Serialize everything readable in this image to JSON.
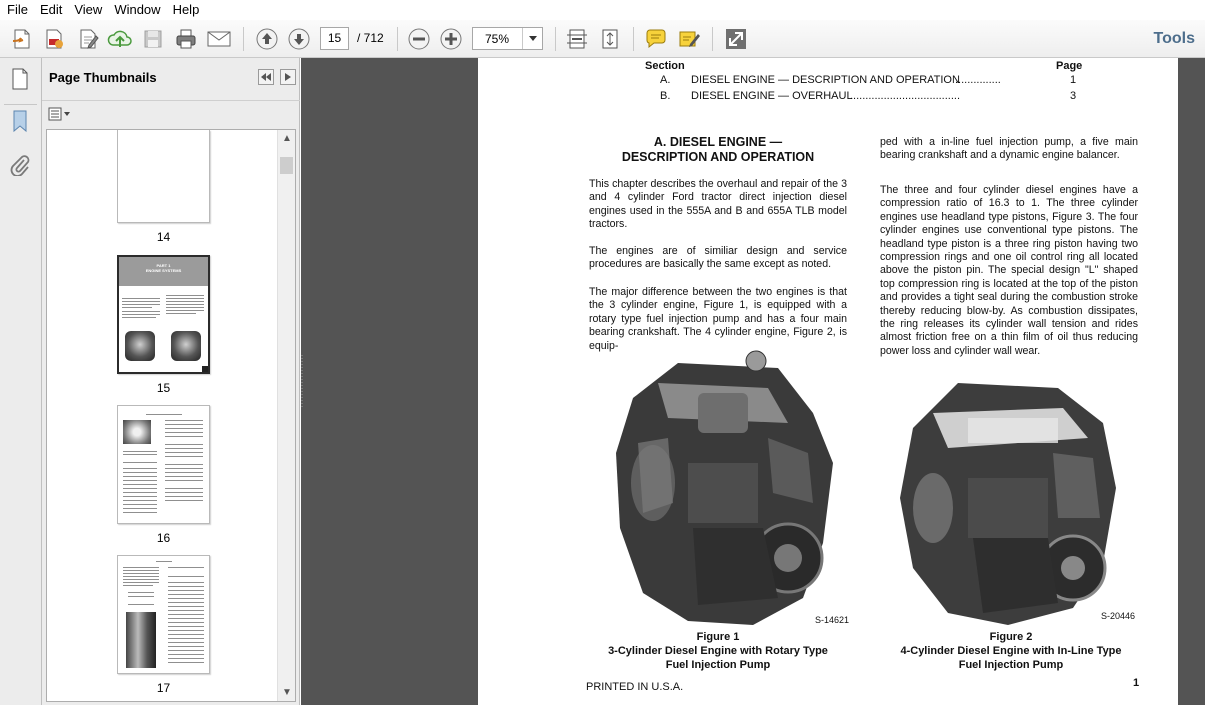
{
  "menu": [
    "File",
    "Edit",
    "View",
    "Window",
    "Help"
  ],
  "toolbar": {
    "page_current": "15",
    "page_total": "/ 712",
    "zoom": "75%",
    "tools_label": "Tools"
  },
  "sidebar": {
    "title": "Page Thumbnails",
    "thumbnails": [
      {
        "label": "14"
      },
      {
        "label": "15",
        "header_line1": "PART 1",
        "header_line2": "ENGINE SYSTEMS"
      },
      {
        "label": "16"
      },
      {
        "label": "17"
      }
    ]
  },
  "document": {
    "toc": {
      "section_header": "Section",
      "page_header": "Page",
      "rows": [
        {
          "letter": "A.",
          "title": "DIESEL ENGINE — DESCRIPTION AND OPERATION",
          "dots": " ...............",
          "page": "1"
        },
        {
          "letter": "B.",
          "title": "DIESEL ENGINE — OVERHAUL",
          "dots": "....................................",
          "page": "3"
        }
      ]
    },
    "heading_line1": "A.   DIESEL ENGINE —",
    "heading_line2": "DESCRIPTION AND OPERATION",
    "left_paragraphs": [
      "This chapter describes the overhaul and repair of the 3 and 4 cylinder Ford tractor direct injection diesel engines used in the 555A and B and 655A TLB model tractors.",
      "The engines are of similiar design and service procedures are basically the same except as noted.",
      "The major difference between the two engines is that the 3 cylinder engine, Figure 1, is equipped with a rotary type fuel injection pump and has a four main bearing crankshaft. The 4 cylinder engine, Figure 2, is equip-"
    ],
    "right_paragraphs": [
      "ped with a in-line fuel injection pump, a five main bearing crankshaft and a dynamic engine balancer.",
      "The three and four cylinder diesel engines have a compression ratio of 16.3 to 1. The three cylinder engines use headland type pistons, Figure 3. The four cylinder engines use conventional type pistons. The headland type piston is a three ring piston having two compression rings and one oil control ring all located above the piston pin. The special design \"L\" shaped top compression ring is located at the top of the piston and provides a tight seal during the combustion stroke thereby reducing blow-by. As combustion dissipates, the ring releases its cylinder wall tension and rides almost friction free on a thin film of oil thus reducing power loss and cylinder wall wear."
    ],
    "figure1": {
      "code": "S-14621",
      "title": "Figure 1",
      "caption_line1": "3-Cylinder Diesel Engine with Rotary Type",
      "caption_line2": "Fuel Injection Pump"
    },
    "figure2": {
      "code": "S-20446",
      "title": "Figure 2",
      "caption_line1": "4-Cylinder Diesel Engine with In-Line Type",
      "caption_line2": "Fuel Injection Pump"
    },
    "footer_left": "PRINTED IN U.S.A.",
    "footer_page": "1"
  },
  "icons": [
    "create-pdf-icon",
    "edit-pdf-icon",
    "edit-icon",
    "upload-icon",
    "save-icon",
    "print-icon",
    "email-icon",
    "page-up-icon",
    "page-down-icon",
    "zoom-out-icon",
    "zoom-in-icon",
    "fit-width-icon",
    "fit-page-icon",
    "comment-icon",
    "sign-icon",
    "fullscreen-icon"
  ]
}
